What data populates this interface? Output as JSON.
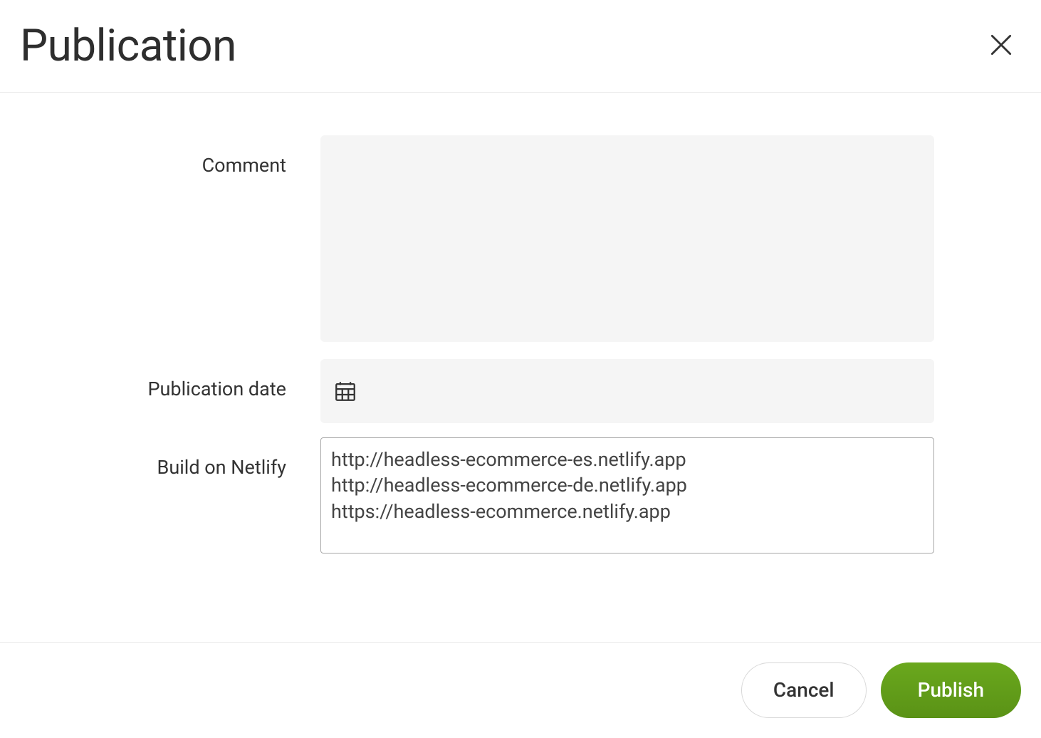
{
  "modal": {
    "title": "Publication",
    "fields": {
      "comment_label": "Comment",
      "comment_value": "",
      "publication_date_label": "Publication date",
      "publication_date_value": "",
      "build_label": "Build on Netlify",
      "build_urls": [
        "http://headless-ecommerce-es.netlify.app",
        "http://headless-ecommerce-de.netlify.app",
        "https://headless-ecommerce.netlify.app"
      ]
    },
    "actions": {
      "cancel_label": "Cancel",
      "publish_label": "Publish"
    }
  }
}
